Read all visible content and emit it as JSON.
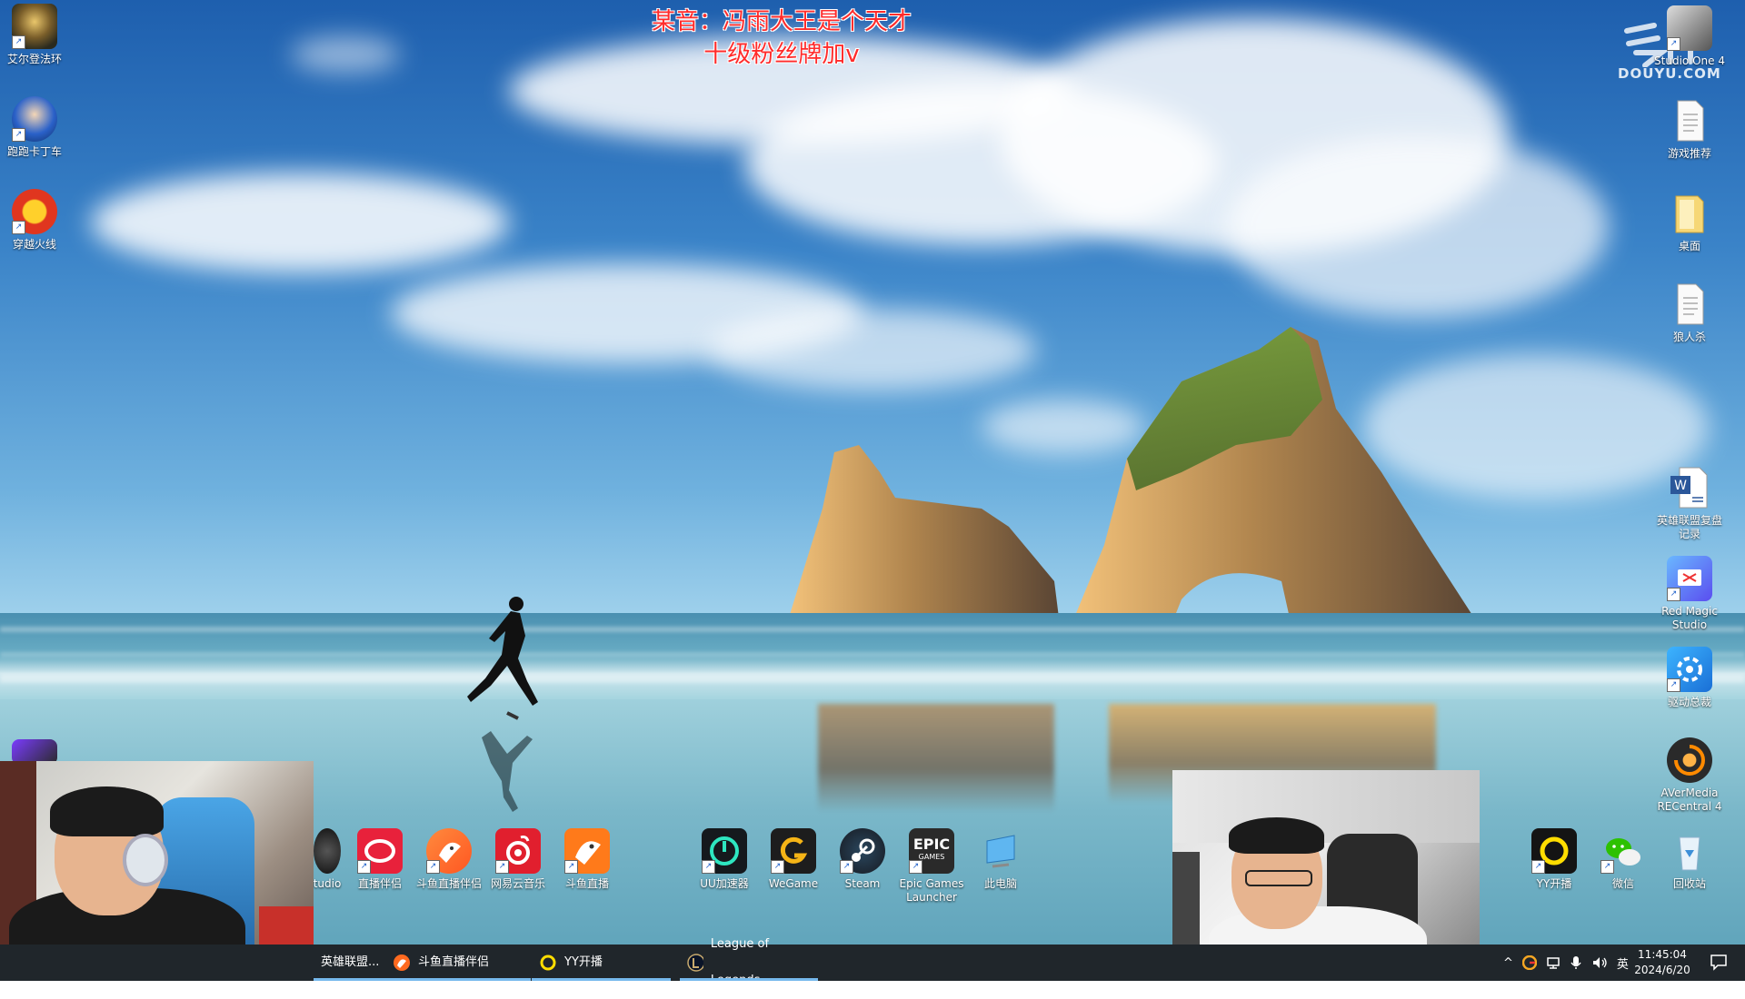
{
  "overlay": {
    "notice_line1": "某音：冯雨大王是个天才",
    "notice_line2": "十级粉丝牌加v",
    "watermark_text": "DOUYU.COM"
  },
  "desktop_left_icons": [
    {
      "label": "艾尔登法环"
    },
    {
      "label": "跑跑卡丁车"
    },
    {
      "label": "穿越火线"
    }
  ],
  "desktop_right_icons": [
    {
      "label": "Studio One 4"
    },
    {
      "label": "游戏推荐"
    },
    {
      "label": "桌面"
    },
    {
      "label": "狼人杀"
    },
    {
      "label": "英雄联盟复盘记录"
    },
    {
      "label": "Red Magic Studio"
    },
    {
      "label": "驱动总裁"
    },
    {
      "label": "AVerMedia RECentral 4"
    }
  ],
  "desktop_bottom_icons": [
    {
      "label": "tudio"
    },
    {
      "label": "直播伴侣"
    },
    {
      "label": "斗鱼直播伴侣"
    },
    {
      "label": "网易云音乐"
    },
    {
      "label": "斗鱼直播"
    },
    {
      "label": "UU加速器"
    },
    {
      "label": "WeGame"
    },
    {
      "label": "Steam"
    },
    {
      "label": "Epic Games Launcher"
    },
    {
      "label": "此电脑"
    },
    {
      "label": "YY开播"
    },
    {
      "label": "微信"
    },
    {
      "label": "回收站"
    }
  ],
  "icon_texts": {
    "epic_glyph": "EPIC",
    "epic_sub": "GAMES"
  },
  "taskbar": {
    "items": [
      {
        "label": "英雄联盟..."
      },
      {
        "label": "斗鱼直播伴侣"
      },
      {
        "label": "YY开播"
      },
      {
        "label": "League of Legends"
      }
    ],
    "ime": "英",
    "time": "11:45:04",
    "date": "2024/6/20"
  },
  "colors": {
    "notice_text": "#ff2b2b",
    "taskbar_bg": "#20262b",
    "active_underline": "#76b9ed"
  }
}
